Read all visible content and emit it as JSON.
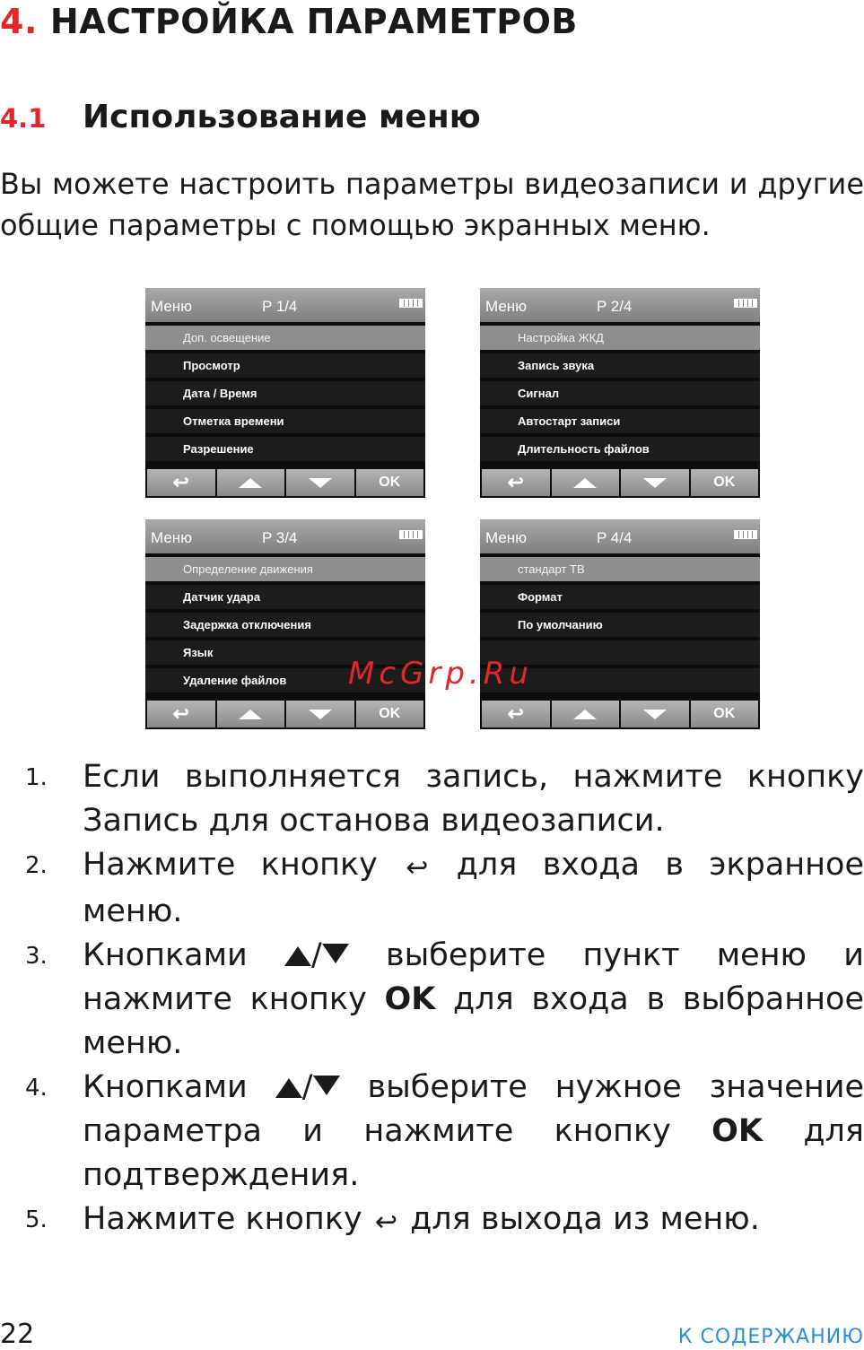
{
  "heading": {
    "number": "4.",
    "title": "НАСТРОЙКА ПАРАМЕТРОВ"
  },
  "subheading": {
    "number": "4.1",
    "title": "Использование меню"
  },
  "intro": "Вы можете настроить параметры видеозаписи и другие общие параметры с помощью экранных меню.",
  "menu_title": "Меню",
  "screens": [
    {
      "page": "P 1/4",
      "items": [
        "Доп. освещение",
        "Просмотр",
        "Дата / Время",
        "Отметка времени",
        "Разрешение"
      ]
    },
    {
      "page": "P 2/4",
      "items": [
        "Настройка ЖКД",
        "Запись звука",
        "Сигнал",
        "Автостарт записи",
        "Длительность файлов"
      ]
    },
    {
      "page": "P 3/4",
      "items": [
        "Определение движения",
        "Датчик удара",
        "Задержка отключения",
        "Язык",
        "Удаление файлов"
      ]
    },
    {
      "page": "P 4/4",
      "items": [
        "стандарт ТВ",
        "Формат",
        "По умолчанию",
        "",
        ""
      ]
    }
  ],
  "buttons": {
    "back": "↩",
    "ok": "OK"
  },
  "watermark": "McGrp.Ru",
  "steps": {
    "s1": {
      "num": "1.",
      "text": "Если выполняется запись, нажмите кнопку Запись для останова видеозаписи."
    },
    "s2": {
      "num": "2.",
      "pre": "Нажмите кнопку",
      "post": "для входа в экранное меню."
    },
    "s3": {
      "num": "3.",
      "pre": "Кнопками",
      "mid": "выберите пункт меню и нажмите кнопку",
      "ok": "OK",
      "post": "для входа в выбранное меню."
    },
    "s4": {
      "num": "4.",
      "pre": "Кнопками",
      "mid": "выберите нужное значение параметра и нажмите кнопку",
      "ok": "OK",
      "post": "для подтверждения."
    },
    "s5": {
      "num": "5.",
      "pre": "Нажмите кнопку",
      "post": "для выхода из меню."
    }
  },
  "footer": {
    "page_number": "22",
    "link": "К СОДЕРЖАНИЮ"
  }
}
